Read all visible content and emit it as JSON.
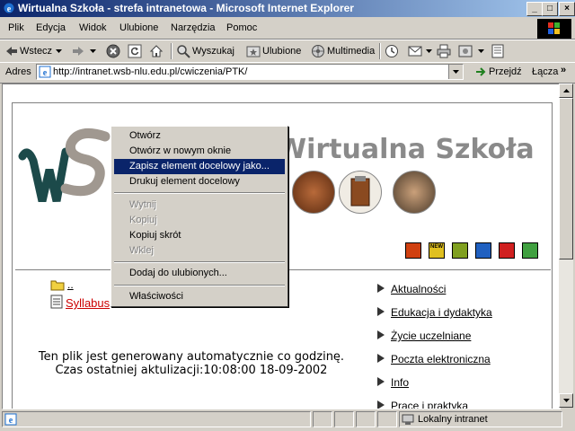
{
  "window": {
    "title": "Wirtualna Szkoła - strefa intranetowa - Microsoft Internet Explorer",
    "min": "_",
    "max": "□",
    "close": "×"
  },
  "menu": [
    "Plik",
    "Edycja",
    "Widok",
    "Ulubione",
    "Narzędzia",
    "Pomoc"
  ],
  "toolbar": {
    "back": "Wstecz",
    "search": "Wyszukaj",
    "favorites": "Ulubione",
    "media": "Multimedia"
  },
  "address": {
    "label": "Adres",
    "url": "http://intranet.wsb-nlu.edu.pl/cwiczenia/PTK/",
    "go": "Przejdź",
    "links": "Łącza"
  },
  "page": {
    "brand": "Wirtualna Szkoła",
    "logo_letters": "WS",
    "folder_link": "..",
    "file_link": "Syllabus",
    "nav": [
      "Aktualności",
      "Edukacja i dydaktyka",
      "Życie uczelniane",
      "Poczta elektroniczna",
      "Info",
      "Prace i praktyka"
    ],
    "footer_line1": "Ten plik jest generowany automatycznie co godzinę.",
    "footer_line2": "Czas ostatniej aktulizacji:10:08:00 18-09-2002",
    "nav_icon_colors": [
      "#d04010",
      "#e0c020",
      "#80a020",
      "#2060c0",
      "#d02020",
      "#40a040"
    ],
    "nav_icon_labels": [
      "",
      "NEW",
      "",
      "",
      "",
      ""
    ]
  },
  "context_menu": {
    "items": [
      {
        "label": "Otwórz",
        "state": "normal"
      },
      {
        "label": "Otwórz w nowym oknie",
        "state": "normal"
      },
      {
        "label": "Zapisz element docelowy jako...",
        "state": "selected"
      },
      {
        "label": "Drukuj element docelowy",
        "state": "normal"
      },
      {
        "label": "Wytnij",
        "state": "disabled"
      },
      {
        "label": "Kopiuj",
        "state": "disabled"
      },
      {
        "label": "Kopiuj skrót",
        "state": "normal"
      },
      {
        "label": "Wklej",
        "state": "disabled"
      },
      {
        "label": "Dodaj do ulubionych...",
        "state": "normal"
      },
      {
        "label": "Właściwości",
        "state": "normal"
      }
    ]
  },
  "status": {
    "zone": "Lokalny intranet"
  },
  "colors": {
    "title_start": "#0a246a",
    "title_end": "#a6caf0",
    "selection": "#0a246a",
    "link_red": "#cc0000",
    "brand_gray": "#8a8a8a"
  }
}
